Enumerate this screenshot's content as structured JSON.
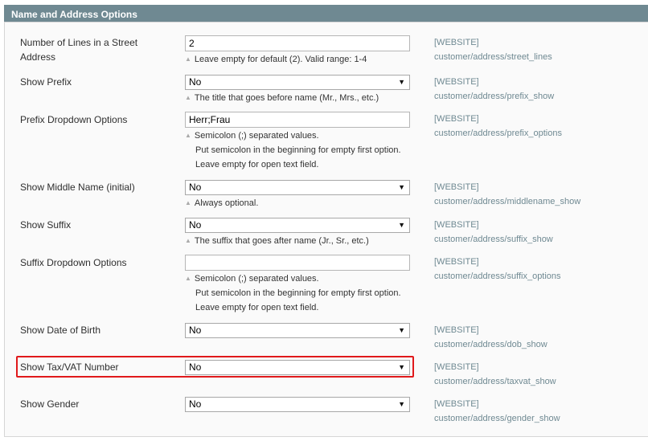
{
  "section": {
    "title": "Name and Address Options"
  },
  "rows": [
    {
      "label_lines": [
        "Number of Lines in a Street",
        "Address"
      ],
      "type": "input",
      "value": "2",
      "notes": [
        "Leave empty for default (2). Valid range: 1-4"
      ],
      "scope": "[WEBSITE]",
      "path": "customer/address/street_lines"
    },
    {
      "label": "Show Prefix",
      "type": "select",
      "value": "No",
      "notes": [
        "The title that goes before name (Mr., Mrs., etc.)"
      ],
      "scope": "[WEBSITE]",
      "path": "customer/address/prefix_show"
    },
    {
      "label": "Prefix Dropdown Options",
      "type": "input",
      "value": "Herr;Frau",
      "notes": [
        "Semicolon (;) separated values.",
        "Put semicolon in the beginning for empty first option.",
        "Leave empty for open text field."
      ],
      "scope": "[WEBSITE]",
      "path": "customer/address/prefix_options"
    },
    {
      "label": "Show Middle Name (initial)",
      "type": "select",
      "value": "No",
      "notes": [
        "Always optional."
      ],
      "scope": "[WEBSITE]",
      "path": "customer/address/middlename_show"
    },
    {
      "label": "Show Suffix",
      "type": "select",
      "value": "No",
      "notes": [
        "The suffix that goes after name (Jr., Sr., etc.)"
      ],
      "scope": "[WEBSITE]",
      "path": "customer/address/suffix_show"
    },
    {
      "label": "Suffix Dropdown Options",
      "type": "input",
      "value": "",
      "notes": [
        "Semicolon (;) separated values.",
        "Put semicolon in the beginning for empty first option.",
        "Leave empty for open text field."
      ],
      "scope": "[WEBSITE]",
      "path": "customer/address/suffix_options"
    },
    {
      "label": "Show Date of Birth",
      "type": "select",
      "value": "No",
      "notes": [],
      "scope": "[WEBSITE]",
      "path": "customer/address/dob_show"
    },
    {
      "label": "Show Tax/VAT Number",
      "type": "select",
      "value": "No",
      "notes": [],
      "scope": "[WEBSITE]",
      "path": "customer/address/taxvat_show",
      "highlighted": true
    },
    {
      "label": "Show Gender",
      "type": "select",
      "value": "No",
      "notes": [],
      "scope": "[WEBSITE]",
      "path": "customer/address/gender_show"
    }
  ],
  "icons": {
    "select_arrow": "▼",
    "note_marker": "▲"
  },
  "colors": {
    "header_bg": "#6f8992",
    "highlight_border": "#e0191b",
    "scope_text": "#6f8992"
  }
}
